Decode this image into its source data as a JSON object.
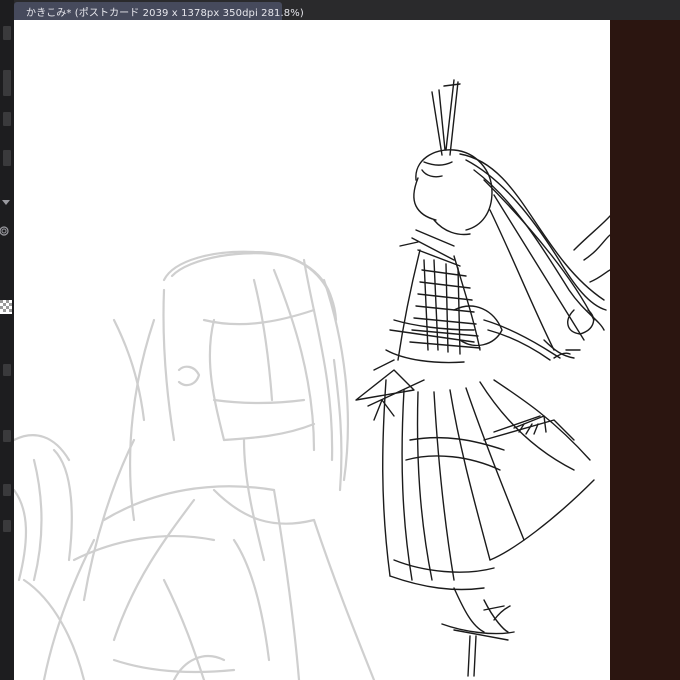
{
  "document_tab": {
    "title": "かきこみ* (ポストカード 2039 x 1378px 350dpi 281.8%)"
  },
  "colors": {
    "canvas": "#ffffff",
    "pasteboard": "#2b1510",
    "tab_active": "#464a5c",
    "sketch_dark": "#1b1b1b",
    "sketch_light": "#cfcfcf"
  },
  "canvas_layers": [
    {
      "name": "rough-sketch-layer",
      "kind": "light gray rough figure"
    },
    {
      "name": "line-art-layer",
      "kind": "dark line drawing of figure in hakama"
    }
  ]
}
